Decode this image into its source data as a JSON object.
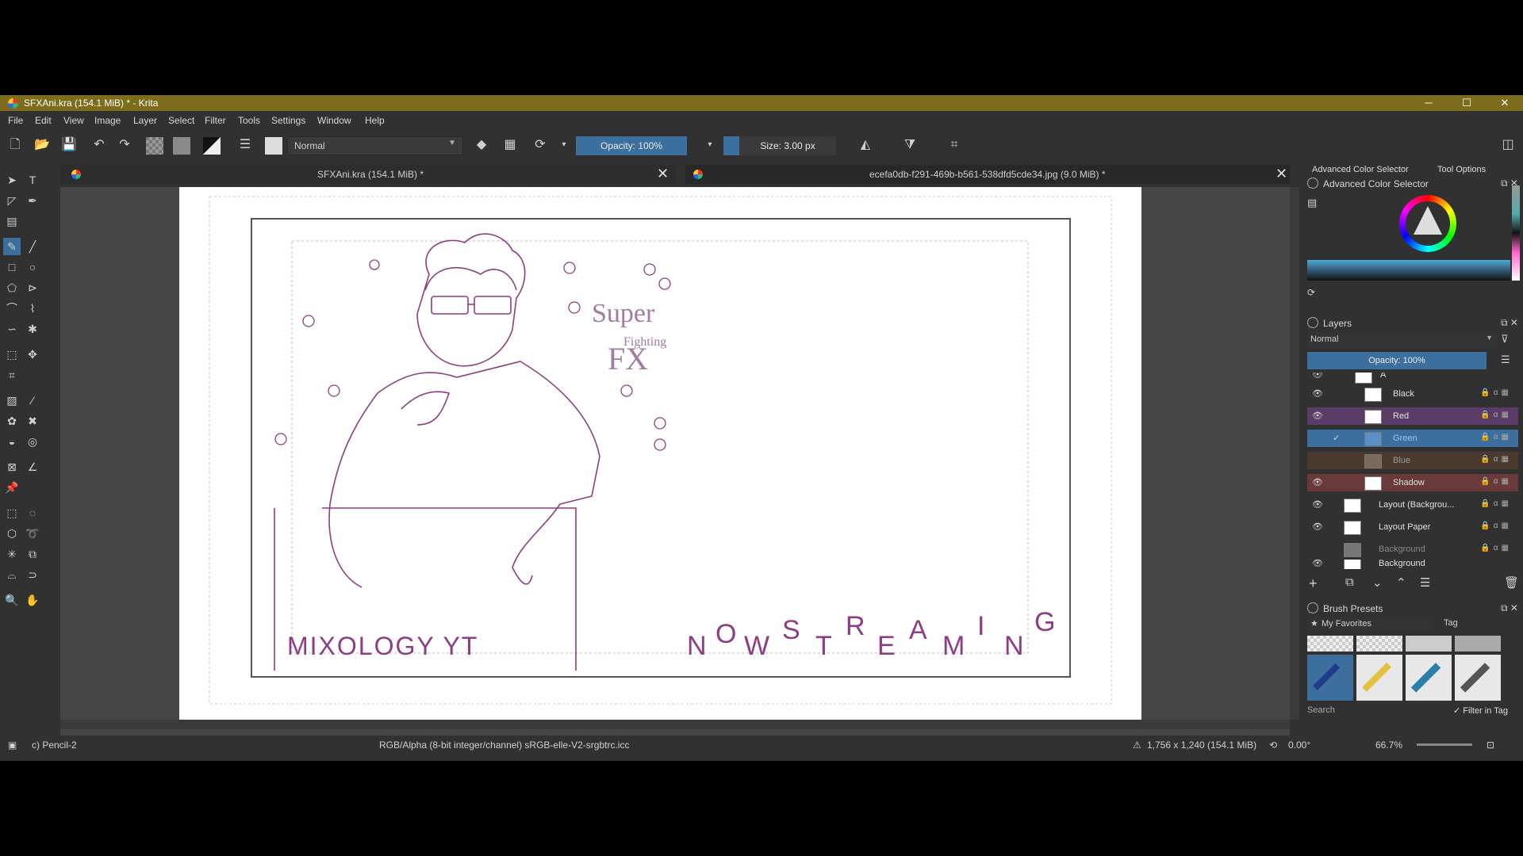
{
  "window": {
    "title": "SFXAni.kra (154.1 MiB) * - Krita",
    "minimize": "─",
    "maximize": "☐",
    "close": "✕"
  },
  "menu": [
    "File",
    "Edit",
    "View",
    "Image",
    "Layer",
    "Select",
    "Filter",
    "Tools",
    "Settings",
    "Window",
    "Help"
  ],
  "toolbar": {
    "blend_mode": "Normal",
    "opacity": "Opacity: 100%",
    "size": "Size: 3.00 px"
  },
  "tabs": [
    {
      "label": "SFXAni.kra (154.1 MiB) *"
    },
    {
      "label": "ecefa0db-f291-469b-b561-538dfd5cde34.jpg (9.0 MiB) *"
    }
  ],
  "canvas": {
    "bottom_left_text": "MIXOLOGY YT",
    "now_streaming": [
      "N",
      "O",
      "W",
      "S",
      "T",
      "R",
      "E",
      "A",
      "M",
      "I",
      "N",
      "G"
    ],
    "sfx_text_1": "Super",
    "sfx_text_2": "Fighting",
    "sfx_text_3": "FX"
  },
  "docker": {
    "tab_color": "Advanced Color Selector",
    "tab_tool": "Tool Options",
    "color_header": "Advanced Color Selector",
    "layers_header": "Layers",
    "layers_blend": "Normal",
    "layers_opacity": "Opacity: 100%",
    "layers": [
      {
        "name": "A",
        "visible": true
      },
      {
        "name": "Black",
        "visible": true
      },
      {
        "name": "Red",
        "visible": true
      },
      {
        "name": "Green",
        "visible": false,
        "selected": true
      },
      {
        "name": "Blue",
        "visible": false
      },
      {
        "name": "Shadow",
        "visible": true
      },
      {
        "name": "Layout (Backgrou...",
        "visible": true
      },
      {
        "name": "Layout Paper",
        "visible": true
      },
      {
        "name": "Background",
        "visible": false
      },
      {
        "name": "Background",
        "visible": true
      }
    ],
    "brush_header": "Brush Presets",
    "brush_tag": "My Favorites",
    "tag_label": "Tag",
    "search_placeholder": "Search",
    "filter_in_tag": "Filter in Tag"
  },
  "status": {
    "brush": "c) Pencil-2",
    "colorspace": "RGB/Alpha (8-bit integer/channel)  sRGB-elle-V2-srgbtrc.icc",
    "dimensions": "1,756 x 1,240 (154.1 MiB)",
    "rotation": "0.00°",
    "zoom": "66.7%"
  },
  "colors": {
    "accent": "#3c6f9e",
    "titlebar": "#7c6c1c",
    "ink": "#8e3d84"
  }
}
